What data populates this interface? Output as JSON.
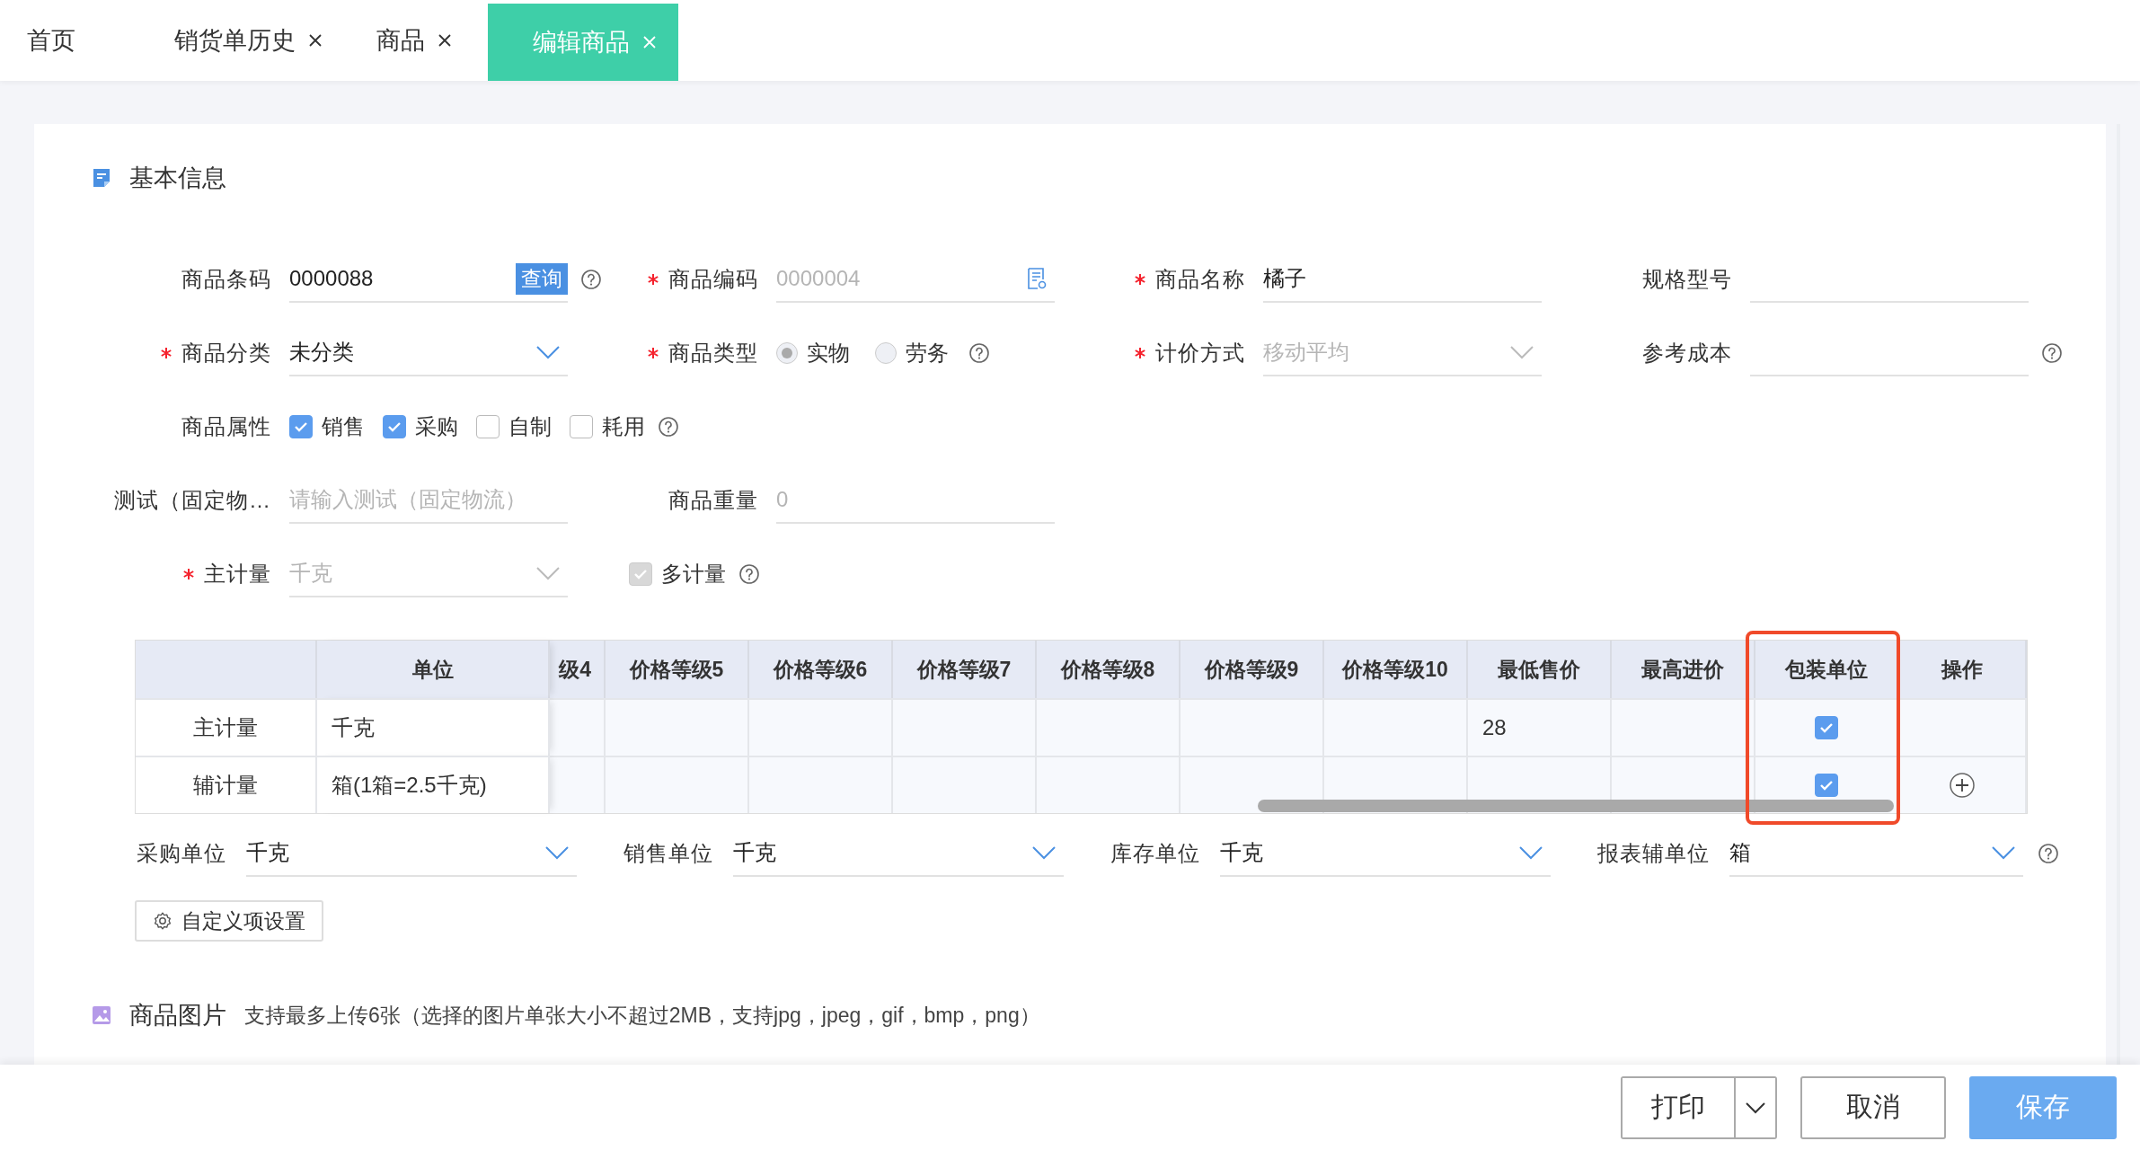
{
  "tabs": [
    {
      "label": "首页",
      "closable": false,
      "selected": false
    },
    {
      "label": "销货单历史",
      "closable": true,
      "selected": false
    },
    {
      "label": "商品",
      "closable": true,
      "selected": false
    },
    {
      "label": "编辑商品",
      "closable": true,
      "selected": true
    }
  ],
  "section": {
    "title": "基本信息"
  },
  "form_rows": [
    [
      {
        "kind": "text",
        "label": "商品条码",
        "value": "0000088",
        "button": "查询",
        "help": true
      },
      {
        "kind": "text",
        "label": "商品编码",
        "required": true,
        "placeholder": "0000004",
        "icon": true
      },
      {
        "kind": "text",
        "label": "商品名称",
        "required": true,
        "value": "橘子"
      },
      {
        "kind": "text",
        "label": "规格型号"
      }
    ],
    [
      {
        "kind": "select",
        "label": "商品分类",
        "required": true,
        "value": "未分类",
        "disabled": false
      },
      {
        "kind": "radio",
        "label": "商品类型",
        "required": true,
        "disabled": true,
        "help": true,
        "options": [
          {
            "label": "实物",
            "selected": true
          },
          {
            "label": "劳务",
            "selected": false
          }
        ]
      },
      {
        "kind": "select",
        "label": "计价方式",
        "required": true,
        "value": "移动平均",
        "disabled": true
      },
      {
        "kind": "text",
        "label": "参考成本",
        "help": true
      }
    ],
    [
      {
        "kind": "checks",
        "label": "商品属性",
        "help": true,
        "options": [
          {
            "label": "销售",
            "checked": true
          },
          {
            "label": "采购",
            "checked": true
          },
          {
            "label": "自制",
            "checked": false
          },
          {
            "label": "耗用",
            "checked": false
          }
        ]
      }
    ],
    [
      {
        "kind": "text",
        "label": "测试（固定物…",
        "placeholder": "请输入测试（固定物流）"
      },
      {
        "kind": "text",
        "label": "商品重量",
        "placeholder": "0"
      }
    ],
    [
      {
        "kind": "select",
        "label": "主计量",
        "required": true,
        "value": "千克",
        "disabled": true
      },
      {
        "kind": "check",
        "label": "多计量",
        "checked": true,
        "disabled": true,
        "help": true
      }
    ]
  ],
  "table": {
    "columns": [
      {
        "label": "单位",
        "kind": "unit",
        "highlighted": false
      },
      {
        "label": "级4",
        "kind": "price",
        "highlighted": false
      },
      {
        "label": "价格等级5",
        "kind": "price",
        "highlighted": false
      },
      {
        "label": "价格等级6",
        "kind": "price",
        "highlighted": false
      },
      {
        "label": "价格等级7",
        "kind": "price",
        "highlighted": false
      },
      {
        "label": "价格等级8",
        "kind": "price",
        "highlighted": false
      },
      {
        "label": "价格等级9",
        "kind": "price",
        "highlighted": false
      },
      {
        "label": "价格等级10",
        "kind": "price",
        "highlighted": false
      },
      {
        "label": "最低售价",
        "kind": "min_price",
        "highlighted": false
      },
      {
        "label": "最高进价",
        "kind": "max_price",
        "highlighted": false
      },
      {
        "label": "包装单位",
        "kind": "pack",
        "highlighted": true
      },
      {
        "label": "操作",
        "kind": "action",
        "highlighted": false
      }
    ],
    "rows": [
      {
        "name": "主计量",
        "unit": "千克",
        "min_price": "28",
        "pack_unit": true,
        "can_add": false
      },
      {
        "name": "辅计量",
        "unit": "箱(1箱=2.5千克)",
        "pack_unit": true,
        "can_add": true
      }
    ]
  },
  "units": [
    {
      "label": "采购单位",
      "value": "千克"
    },
    {
      "label": "销售单位",
      "value": "千克"
    },
    {
      "label": "库存单位",
      "value": "千克"
    },
    {
      "label": "报表辅单位",
      "value": "箱",
      "help": true
    }
  ],
  "custom_button": "自定义项设置",
  "images": {
    "title": "商品图片",
    "hint": "支持最多上传6张（选择的图片单张大小不超过2MB，支持jpg，jpeg，gif，bmp，png）"
  },
  "footer": {
    "print": "打印",
    "cancel": "取消",
    "save": "保存"
  }
}
